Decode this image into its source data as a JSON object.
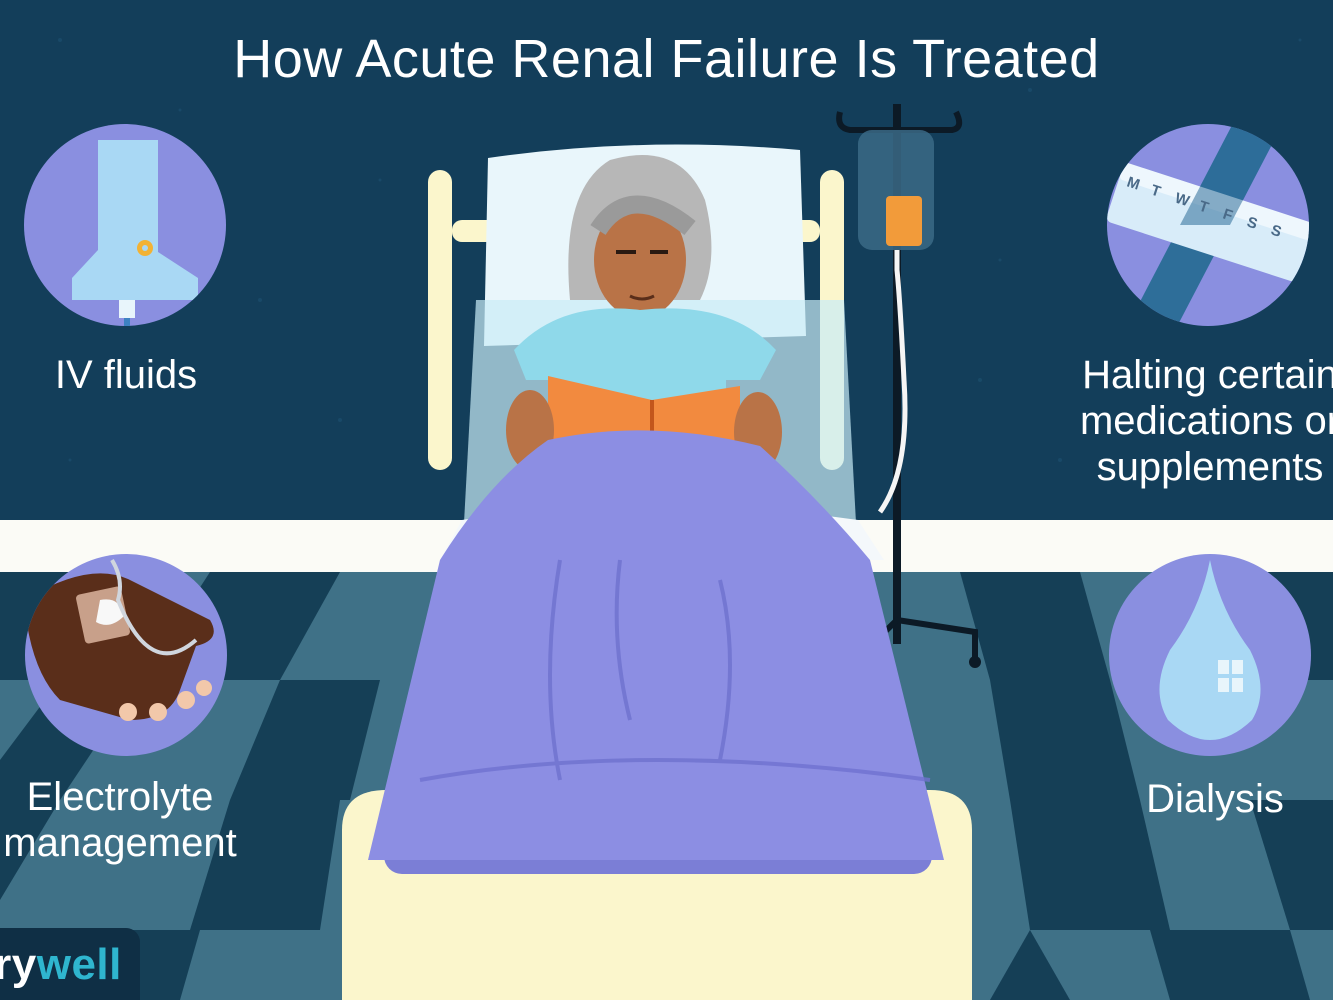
{
  "title": "How Acute Renal Failure Is Treated",
  "treatments": {
    "iv_fluids": "IV fluids",
    "halting_line1": "Halting certain",
    "halting_line2": "medications or",
    "halting_line3": "supplements",
    "electrolyte_line1": "Electrolyte",
    "electrolyte_line2": "management",
    "dialysis": "Dialysis"
  },
  "pill_box_days": [
    "M",
    "T",
    "W",
    "T",
    "F",
    "S",
    "S"
  ],
  "logo": {
    "prefix": "ry",
    "suffix": "well"
  },
  "colors": {
    "wall": "#133e5a",
    "floor_dark": "#153f56",
    "floor_light": "#3f7187",
    "circle": "#8a8fe0",
    "blanket": "#8c8ee3",
    "bed_frame": "#fbf6cc",
    "logo_teal": "#2fb6cf"
  }
}
